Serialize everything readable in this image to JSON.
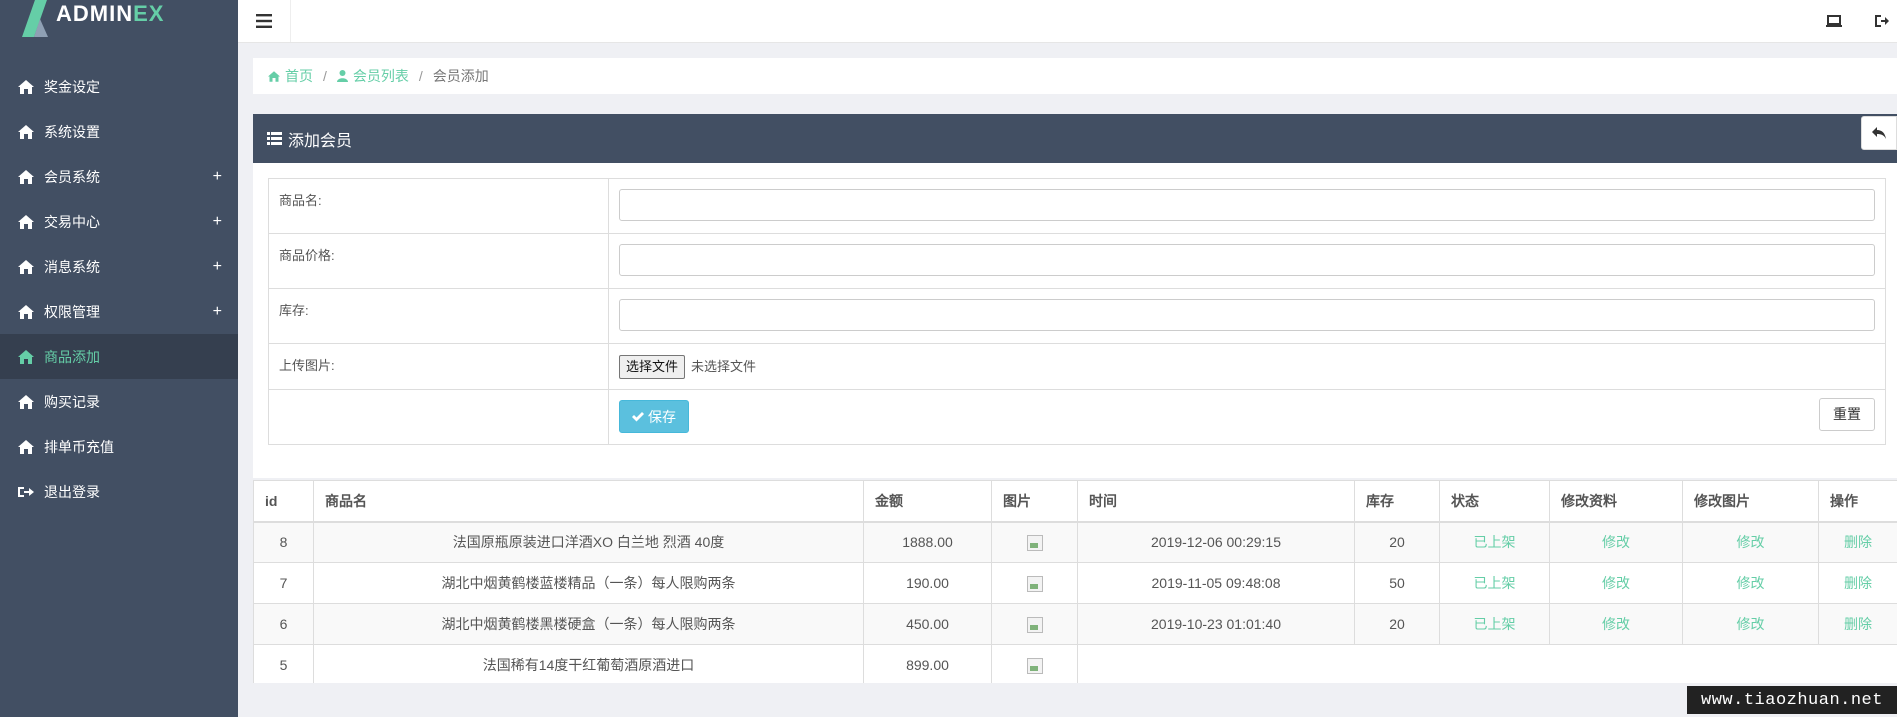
{
  "brand": {
    "name_main": "ADMIN",
    "name_accent": "EX"
  },
  "sidebar": {
    "items": [
      {
        "label": "奖金设定",
        "icon": "home-icon",
        "expandable": false
      },
      {
        "label": "系统设置",
        "icon": "home-icon",
        "expandable": false
      },
      {
        "label": "会员系统",
        "icon": "home-icon",
        "expandable": true
      },
      {
        "label": "交易中心",
        "icon": "home-icon",
        "expandable": true
      },
      {
        "label": "消息系统",
        "icon": "home-icon",
        "expandable": true
      },
      {
        "label": "权限管理",
        "icon": "home-icon",
        "expandable": true
      },
      {
        "label": "商品添加",
        "icon": "home-icon",
        "expandable": false,
        "active": true
      },
      {
        "label": "购买记录",
        "icon": "home-icon",
        "expandable": false
      },
      {
        "label": "排单币充值",
        "icon": "home-icon",
        "expandable": false
      },
      {
        "label": "退出登录",
        "icon": "sign-out-icon",
        "expandable": false
      }
    ],
    "expand_symbol": "+"
  },
  "breadcrumb": {
    "home": "首页",
    "list": "会员列表",
    "current": "会员添加",
    "separator": "/"
  },
  "panel": {
    "title": "添加会员"
  },
  "form": {
    "name_label": "商品名:",
    "price_label": "商品价格:",
    "stock_label": "库存:",
    "image_label": "上传图片:",
    "file_button": "选择文件",
    "file_status": "未选择文件",
    "save_button": "保存",
    "reset_button": "重置"
  },
  "table": {
    "headers": [
      "id",
      "商品名",
      "金额",
      "图片",
      "时间",
      "库存",
      "状态",
      "修改资料",
      "修改图片",
      "操作"
    ],
    "rows": [
      {
        "id": "8",
        "name": "法国原瓶原装进口洋酒XO 白兰地 烈酒 40度",
        "amount": "1888.00",
        "time": "2019-12-06 00:29:15",
        "stock": "20",
        "status": "已上架",
        "edit_info": "修改",
        "edit_image": "修改",
        "action": "删除"
      },
      {
        "id": "7",
        "name": "湖北中烟黄鹤楼蓝楼精品（一条）每人限购两条",
        "amount": "190.00",
        "time": "2019-11-05 09:48:08",
        "stock": "50",
        "status": "已上架",
        "edit_info": "修改",
        "edit_image": "修改",
        "action": "删除"
      },
      {
        "id": "6",
        "name": "湖北中烟黄鹤楼黑楼硬盒（一条）每人限购两条",
        "amount": "450.00",
        "time": "2019-10-23 01:01:40",
        "stock": "20",
        "status": "已上架",
        "edit_info": "修改",
        "edit_image": "修改",
        "action": "删除"
      },
      {
        "id": "5",
        "name": "法国稀有14度干红葡萄酒原酒进口",
        "amount": "899.00"
      }
    ]
  },
  "watermark": "www.tiaozhuan.net",
  "colors": {
    "sidebar_bg": "#424f63",
    "accent": "#65cea7",
    "info_button": "#5bc0de",
    "page_bg": "#eff0f4"
  }
}
